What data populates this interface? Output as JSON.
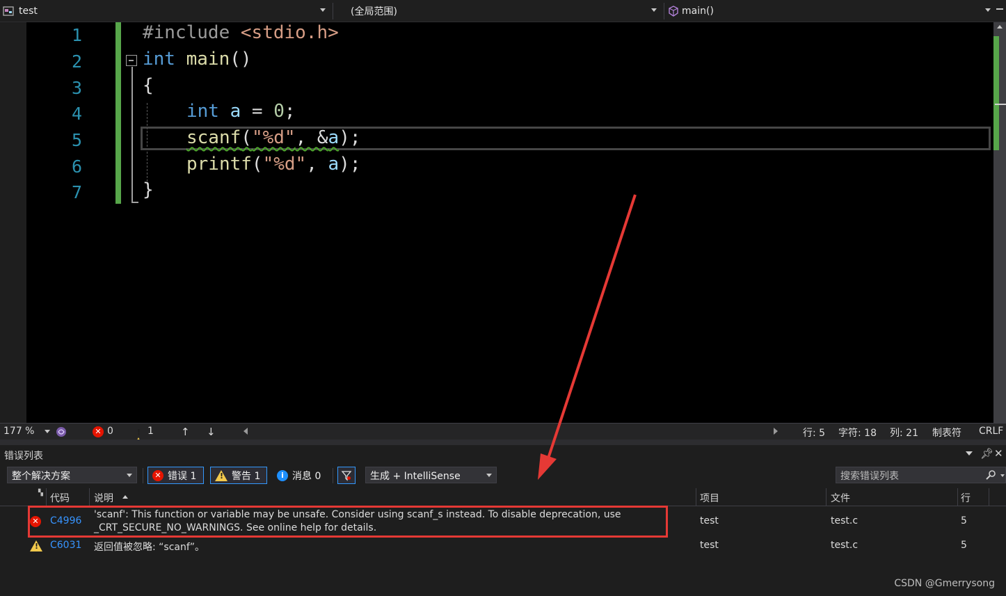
{
  "navbar": {
    "project": "test",
    "scope": "(全局范围)",
    "member": "main()"
  },
  "editor": {
    "line_numbers": [
      "1",
      "2",
      "3",
      "4",
      "5",
      "6",
      "7"
    ],
    "lines": {
      "l1_pp": "#include ",
      "l1_hdr": "<stdio.h>",
      "l2_kw": "int",
      "l2_fn": " main",
      "l2_rest": "()",
      "l3": "{",
      "l4_kw": "int",
      "l4_var": " a",
      "l4_eq": " = ",
      "l4_num": "0",
      "l4_end": ";",
      "l5_fn": "scanf",
      "l5_p1": "(",
      "l5_str": "\"%d\"",
      "l5_comma": ", &",
      "l5_var": "a",
      "l5_end": ");",
      "l6_fn": "printf",
      "l6_p1": "(",
      "l6_str": "\"%d\"",
      "l6_comma": ", ",
      "l6_var": "a",
      "l6_end": ");",
      "l7": "}"
    }
  },
  "status": {
    "zoom": "177 %",
    "errors": "0",
    "warnings": "1",
    "line": "行: 5",
    "char": "字符: 18",
    "col": "列: 21",
    "tab_mode": "制表符",
    "eol": "CRLF"
  },
  "error_list": {
    "title": "错误列表",
    "scope_filter": "整个解决方案",
    "errors_btn": "错误 1",
    "warnings_btn": "警告 1",
    "messages_btn": "消息 0",
    "source_filter": "生成 + IntelliSense",
    "search_placeholder": "搜索错误列表",
    "columns": {
      "code": "代码",
      "desc": "说明",
      "project": "项目",
      "file": "文件",
      "line": "行"
    },
    "rows": [
      {
        "code": "C4996",
        "desc_line1": "'scanf': This function or variable may be unsafe. Consider using scanf_s instead. To disable deprecation, use",
        "desc_line2": "_CRT_SECURE_NO_WARNINGS. See online help for details.",
        "project": "test",
        "file": "test.c",
        "line": "5"
      },
      {
        "code": "C6031",
        "desc": "返回值被忽略: “scanf”。",
        "project": "test",
        "file": "test.c",
        "line": "5"
      }
    ]
  },
  "watermark": "CSDN @Gmerrysong",
  "colors": {
    "accent_red": "#e53935",
    "changebar_green": "#57a64a",
    "keyword": "#569cd6",
    "function": "#dcdcaa",
    "variable": "#9cdcfe",
    "string": "#d69d85",
    "line_number": "#2b91af"
  }
}
